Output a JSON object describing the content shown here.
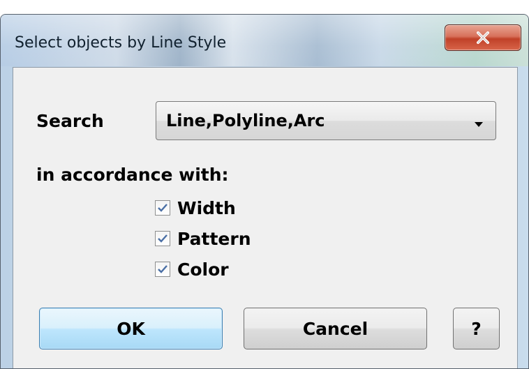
{
  "dialog": {
    "title": "Select objects by Line Style",
    "close_icon": "close-x-icon"
  },
  "search": {
    "label": "Search",
    "selected": "Line,Polyline,Arc"
  },
  "criteria": {
    "label": "in accordance with:",
    "items": [
      {
        "label": "Width",
        "checked": true
      },
      {
        "label": "Pattern",
        "checked": true
      },
      {
        "label": "Color",
        "checked": true
      }
    ]
  },
  "buttons": {
    "ok": "OK",
    "cancel": "Cancel",
    "help": "?"
  },
  "colors": {
    "close_button": "#c7452c",
    "default_button_border": "#3c7fb1",
    "checkmark": "#4a6fa5"
  }
}
